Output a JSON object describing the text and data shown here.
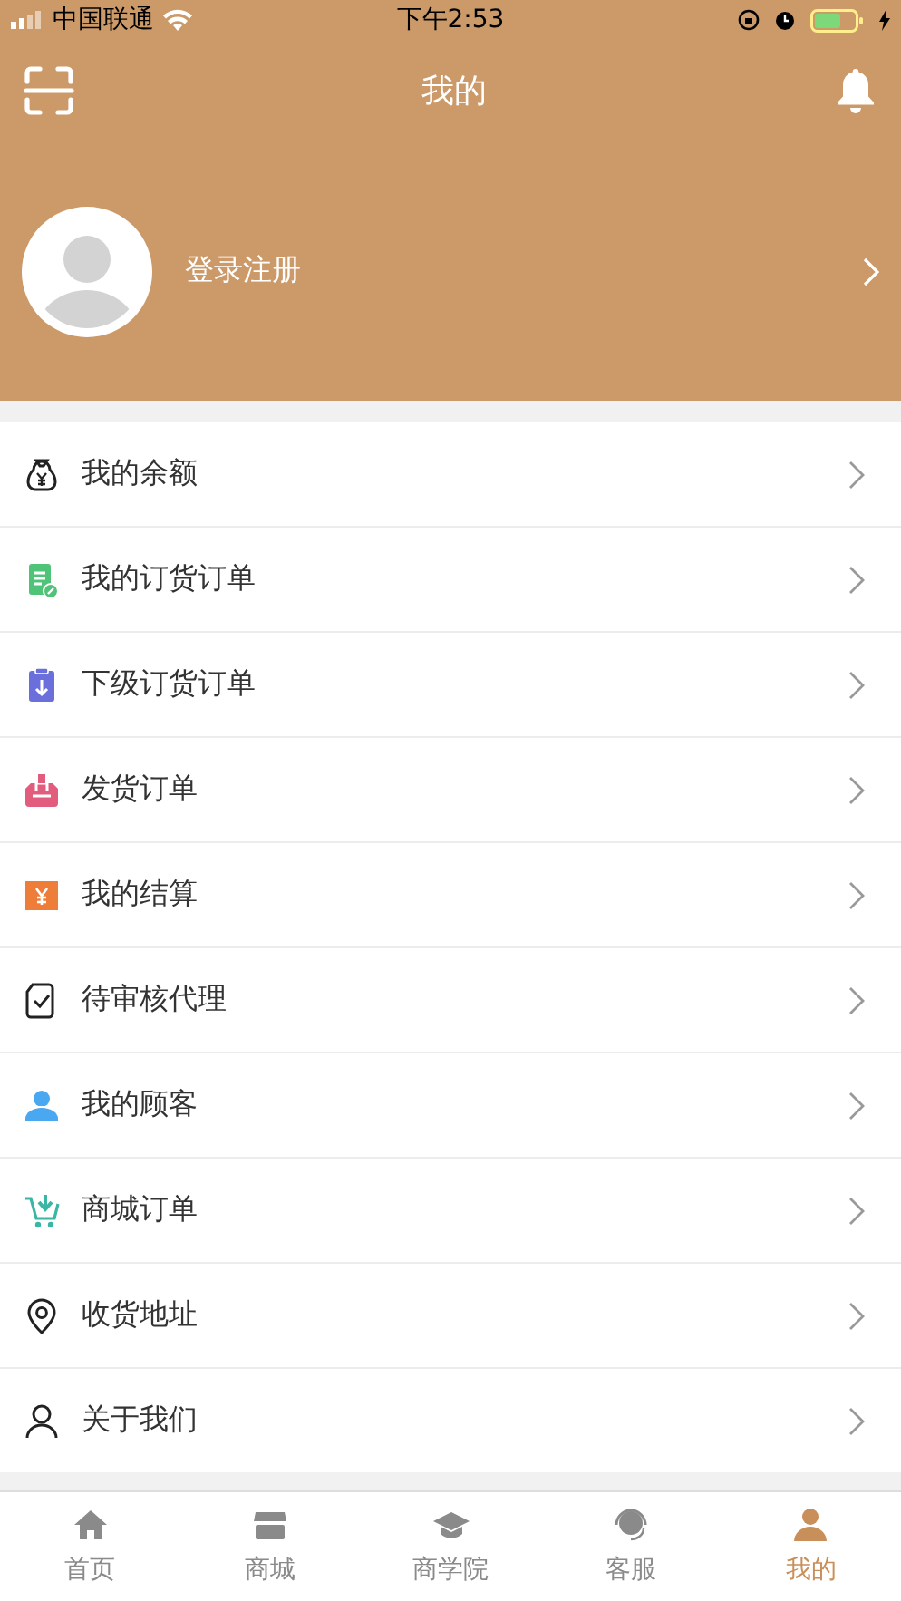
{
  "status_bar": {
    "carrier": "中国联通",
    "time": "下午2:53"
  },
  "nav_bar": {
    "title": "我的"
  },
  "profile": {
    "login_label": "登录注册"
  },
  "menu": [
    {
      "label": "我的余额"
    },
    {
      "label": "我的订货订单"
    },
    {
      "label": "下级订货订单"
    },
    {
      "label": "发货订单"
    },
    {
      "label": "我的结算"
    },
    {
      "label": "待审核代理"
    },
    {
      "label": "我的顾客"
    },
    {
      "label": "商城订单"
    },
    {
      "label": "收货地址"
    },
    {
      "label": "关于我们"
    }
  ],
  "tab_bar": [
    {
      "label": "首页",
      "selected": false
    },
    {
      "label": "商城",
      "selected": false
    },
    {
      "label": "商学院",
      "selected": false
    },
    {
      "label": "客服",
      "selected": false
    },
    {
      "label": "我的",
      "selected": true
    }
  ]
}
